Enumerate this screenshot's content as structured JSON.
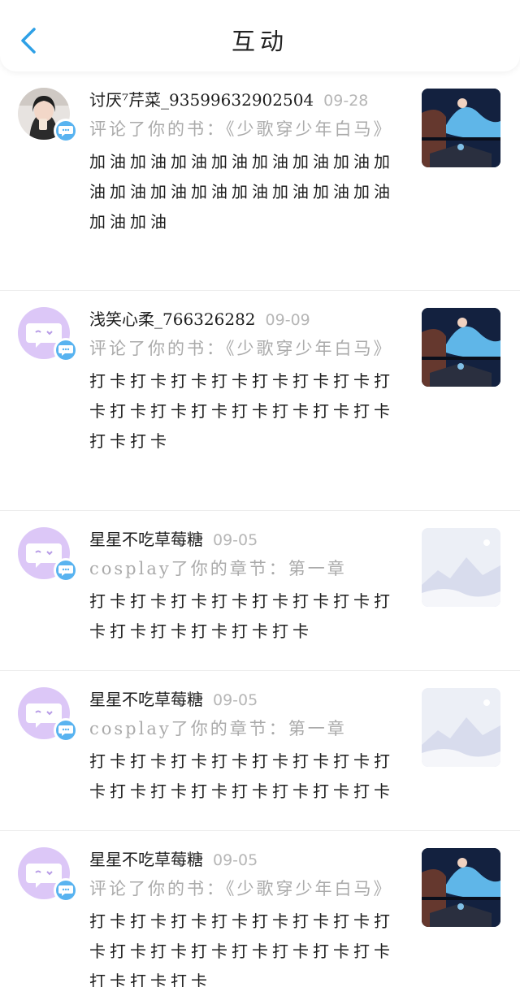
{
  "header": {
    "title": "互动",
    "back_icon": "chevron-left-icon"
  },
  "colors": {
    "accent": "#2ea0e6",
    "badge": "#58b3f0",
    "default_avatar": "#dcc7f7",
    "muted_text": "#aaaaaa"
  },
  "items": [
    {
      "name": "讨厌⁷芹菜_93599632902504",
      "date": "09-28",
      "action": "评论了你的书：《少歌穿少年白马》",
      "comment": "加油加油加油加油加油加油加油加油加油加油加油加油加油加油加油加油加油",
      "avatar": "photo",
      "thumbnail": "book-cover"
    },
    {
      "name": "浅笑心柔_766326282",
      "date": "09-09",
      "action": "评论了你的书：《少歌穿少年白马》",
      "comment": "打卡打卡打卡打卡打卡打卡打卡打卡打卡打卡打卡打卡打卡打卡打卡打卡打卡",
      "avatar": "default",
      "thumbnail": "book-cover"
    },
    {
      "name": "星星不吃草莓糖",
      "date": "09-05",
      "action": "cosplay了你的章节：第一章",
      "comment": "打卡打卡打卡打卡打卡打卡打卡打卡打卡打卡打卡打卡打卡",
      "avatar": "default",
      "thumbnail": "placeholder"
    },
    {
      "name": "星星不吃草莓糖",
      "date": "09-05",
      "action": "cosplay了你的章节：第一章",
      "comment": "打卡打卡打卡打卡打卡打卡打卡打卡打卡打卡打卡打卡打卡打卡打卡",
      "avatar": "default",
      "thumbnail": "placeholder"
    },
    {
      "name": "星星不吃草莓糖",
      "date": "09-05",
      "action": "评论了你的书：《少歌穿少年白马》",
      "comment": "打卡打卡打卡打卡打卡打卡打卡打卡打卡打卡打卡打卡打卡打卡打卡打卡打卡打卡",
      "avatar": "default",
      "thumbnail": "book-cover"
    }
  ]
}
